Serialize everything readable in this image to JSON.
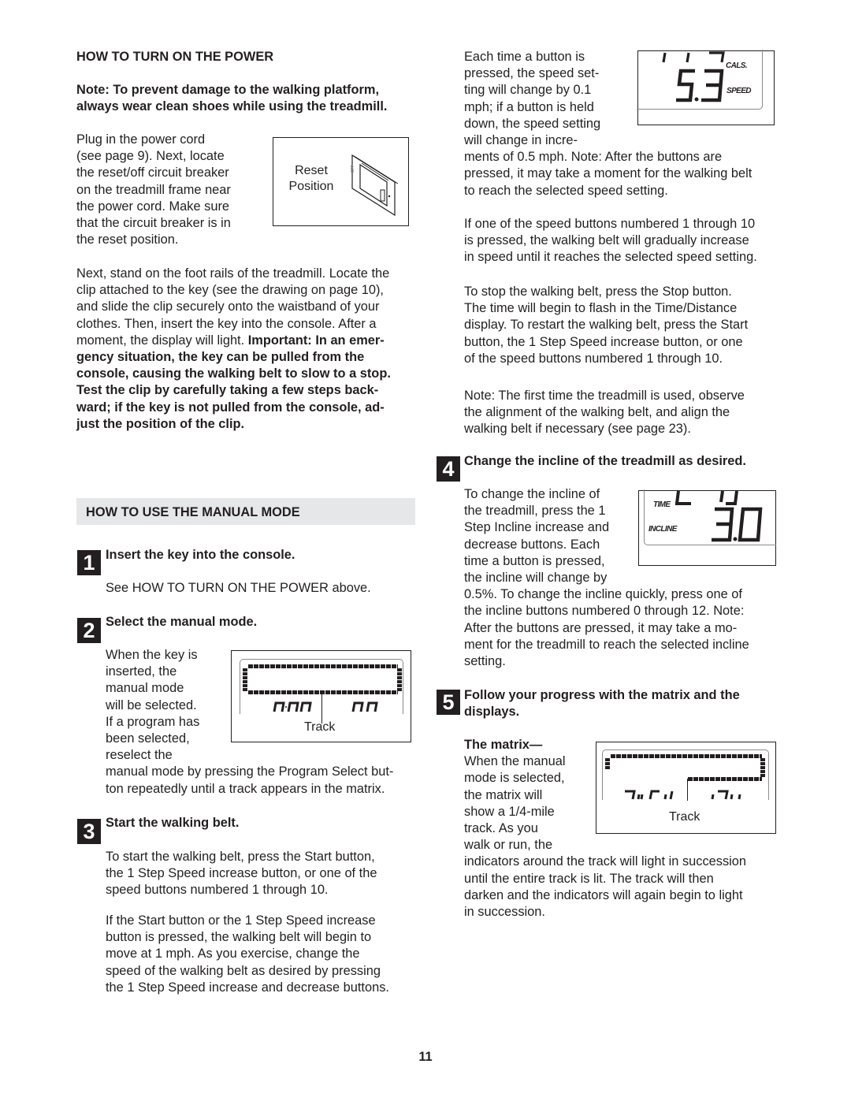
{
  "page_number": "11",
  "power": {
    "heading": "HOW TO TURN ON THE POWER",
    "note_line1": "Note: To prevent damage to the walking platform,",
    "note_line2": "always wear clean shoes while using the treadmill.",
    "plug_lines": [
      "Plug in the power cord",
      "(see page 9). Next, locate",
      "the reset/off circuit breaker",
      "on the treadmill frame near",
      "the power cord. Make sure",
      "that the circuit breaker is in",
      "the reset position."
    ],
    "figure_label_line1": "Reset",
    "figure_label_line2": "Position",
    "clip_lines": [
      "Next, stand on the foot rails of the treadmill. Locate the",
      "clip attached to the key (see the drawing on page 10),",
      "and slide the clip securely onto the waistband of your",
      "clothes. Then, insert the key into the console. After a"
    ],
    "clip_line5_normal": "moment, the display will light. ",
    "clip_line5_bold": "Important: In an emer-",
    "important_lines": [
      "gency situation, the key can be pulled from the",
      "console, causing the walking belt to slow to a stop.",
      "Test the clip by carefully taking a few steps back-",
      "ward; if the key is not pulled from the console, ad-",
      "just the position of the clip."
    ]
  },
  "manual": {
    "heading": "HOW TO USE THE MANUAL MODE",
    "steps": [
      {
        "number": "1",
        "title": "Insert the key into the console.",
        "body": "See HOW TO TURN ON THE POWER above."
      },
      {
        "number": "2",
        "title": "Select the manual mode.",
        "wrap_lines": [
          "When the key is",
          "inserted, the",
          "manual mode",
          "will be selected.",
          "If a program has",
          "been selected,",
          "reselect the"
        ],
        "full_lines": [
          "manual mode by pressing the Program Select but-",
          "ton repeatedly until a track appears in the matrix."
        ],
        "figure_label": "Track"
      },
      {
        "number": "3",
        "title": "Start the walking belt.",
        "para1_lines": [
          "To start the walking belt, press the Start button,",
          "the 1 Step Speed increase button, or one of the",
          "speed buttons numbered 1 through 10."
        ],
        "para2_lines": [
          "If the Start button or the 1 Step Speed increase",
          "button is pressed, the walking belt will begin to",
          "move at 1 mph. As you exercise, change the",
          "speed of the walking belt as desired by pressing",
          "the 1 Step Speed increase and decrease buttons."
        ]
      },
      {
        "number": "4",
        "title": "Change the incline of the treadmill as desired.",
        "wrap_lines": [
          "To change the incline of",
          "the treadmill, press the 1",
          "Step Incline increase and",
          "decrease buttons. Each",
          "time a button is pressed,",
          "the incline will change by"
        ],
        "full_lines": [
          "0.5%. To change the incline quickly, press one of",
          "the incline buttons numbered 0 through 12. Note:",
          "After the buttons are pressed, it may take a mo-",
          "ment for the treadmill to reach the selected incline",
          "setting."
        ],
        "display": {
          "time_label": "TIME",
          "incline_label": "INCLINE",
          "incline_value": "3.0"
        }
      },
      {
        "number": "5",
        "title_line1": "Follow your progress with the matrix and the",
        "title_line2": "displays.",
        "subheading": "The matrix—",
        "wrap_lines": [
          "When the manual",
          "mode is selected,",
          "the matrix will",
          "show a 1/4-mile",
          "track. As you",
          "walk or run, the"
        ],
        "full_lines": [
          "indicators around the track will light in succession",
          "until the entire track is lit. The track will then",
          "darken and the indicators will again begin to light",
          "in succession."
        ],
        "figure_label": "Track"
      }
    ]
  },
  "speed": {
    "wrap_lines": [
      "Each time a button is",
      "pressed, the speed set-",
      "ting will change by 0.1",
      "mph; if a button is held",
      "down, the speed setting",
      "will change in incre-"
    ],
    "full_lines": [
      "ments of 0.5 mph. Note: After the buttons are",
      "pressed, it may take a moment for the walking belt",
      "to reach the selected speed setting."
    ],
    "display": {
      "cals_label": "CALS.",
      "speed_label": "SPEED",
      "speed_value": "5.3"
    },
    "para_gradual": [
      "If one of the speed buttons numbered 1 through 10",
      "is pressed, the walking belt will gradually increase",
      "in speed until it reaches the selected speed setting."
    ],
    "para_stop": [
      "To stop the walking belt, press the Stop button.",
      "The time will begin to flash in the Time/Distance",
      "display. To restart the walking belt, press the Start",
      "button, the 1 Step Speed increase button, or one",
      "of the speed buttons numbered 1 through 10."
    ],
    "para_note": [
      "Note: The first time the treadmill is used, observe",
      "the alignment of the walking belt, and align the",
      "walking belt if necessary (see page 23)."
    ]
  }
}
